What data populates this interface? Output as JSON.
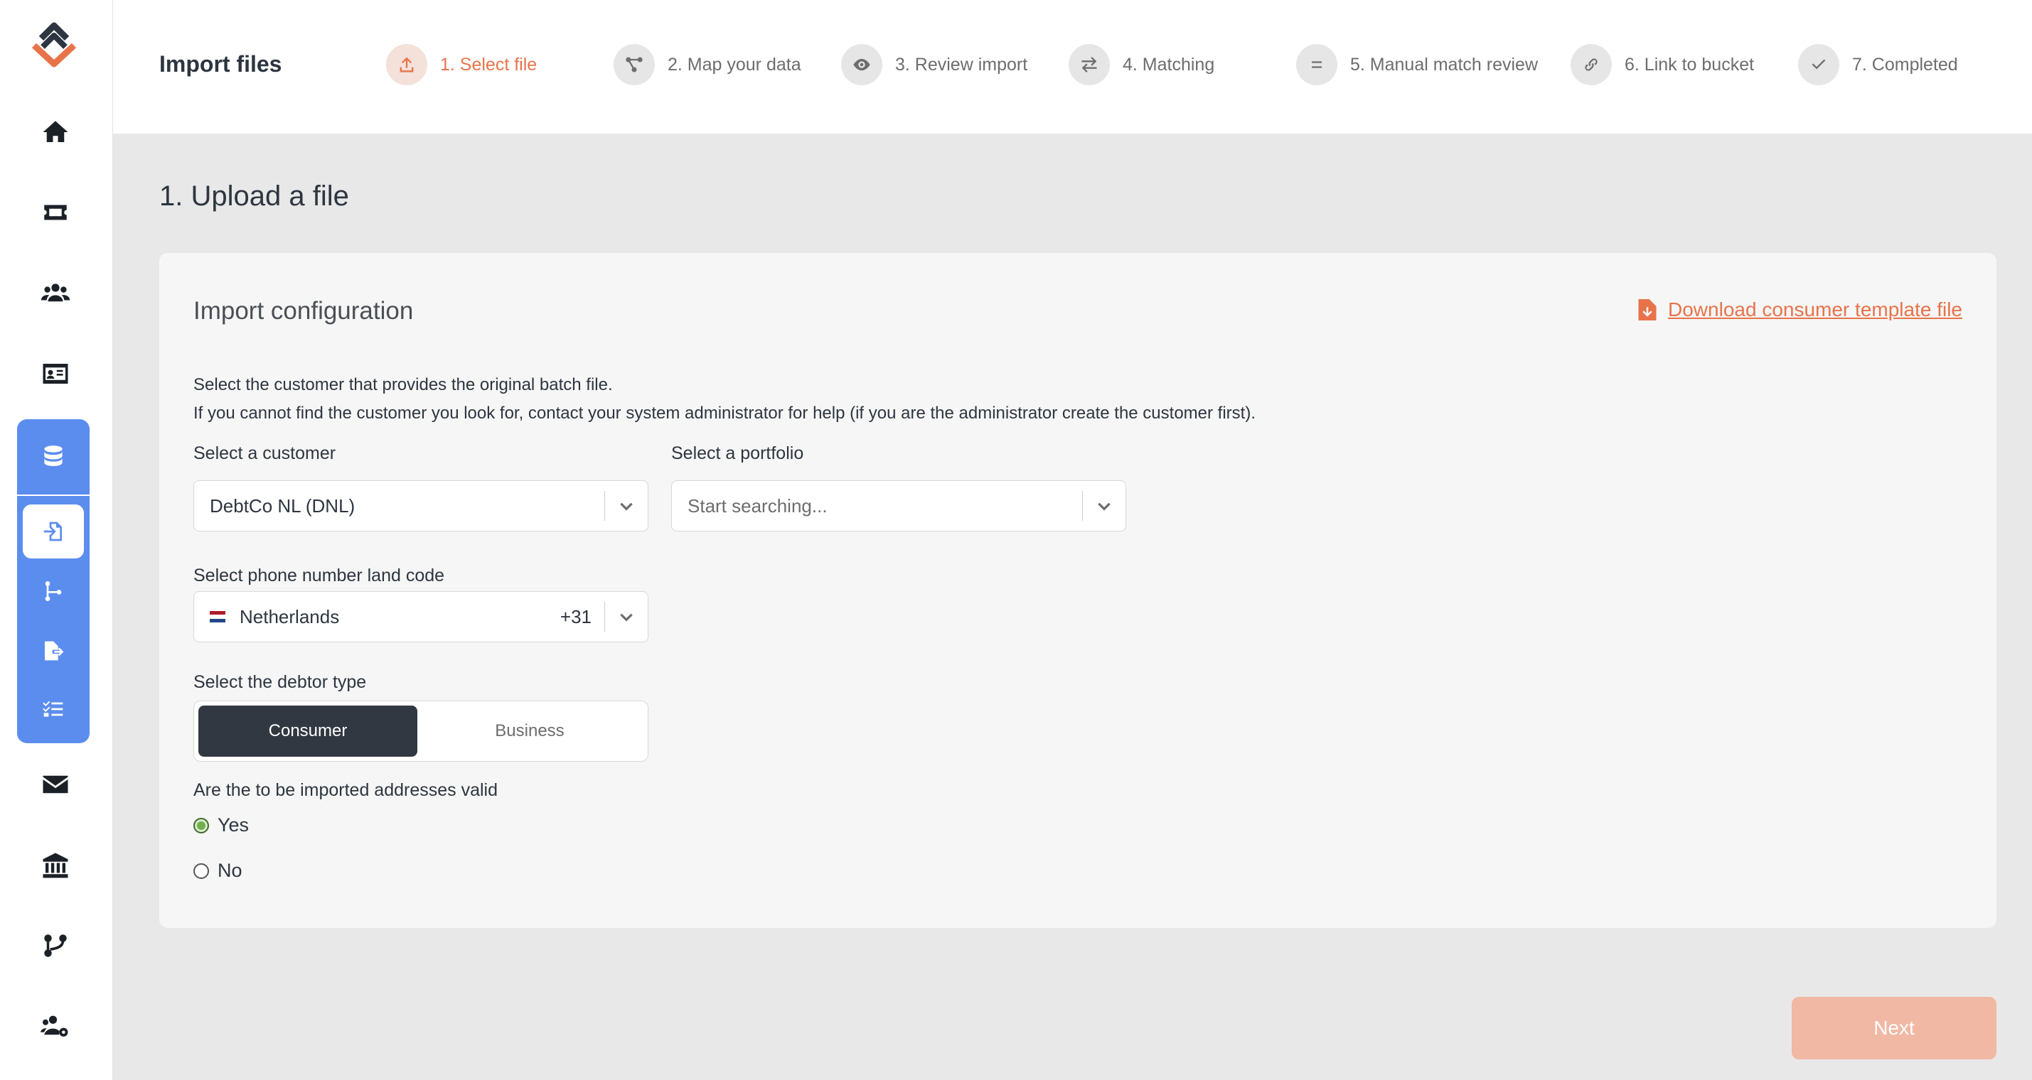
{
  "header": {
    "title": "Import files",
    "steps": [
      {
        "label": "1. Select file",
        "icon": "upload-icon",
        "active": true
      },
      {
        "label": "2. Map your data",
        "icon": "map-icon",
        "active": false
      },
      {
        "label": "3. Review import",
        "icon": "eye-icon",
        "active": false
      },
      {
        "label": "4. Matching",
        "icon": "swap-arrows-icon",
        "active": false
      },
      {
        "label": "5. Manual match review",
        "icon": "equals-icon",
        "active": false
      },
      {
        "label": "6. Link to bucket",
        "icon": "link-icon",
        "active": false
      },
      {
        "label": "7. Completed",
        "icon": "check-icon",
        "active": false
      }
    ]
  },
  "sidebar": {
    "items": [
      "home-icon",
      "ticket-icon",
      "users-icon",
      "id-card-icon",
      "database-icon",
      "mail-icon",
      "bank-icon",
      "branch-icon",
      "users-gear-icon"
    ],
    "sub_items": [
      "file-import-icon",
      "flow-icon",
      "file-export-icon",
      "checklist-icon"
    ]
  },
  "main": {
    "title": "1. Upload a file",
    "card": {
      "title": "Import configuration",
      "download_link": "Download consumer template file",
      "desc_line1": "Select the customer that provides the original batch file.",
      "desc_line2": "If you cannot find the customer you look for, contact your system administrator for help (if you are the administrator create the customer first).",
      "customer": {
        "label": "Select a customer",
        "value": "DebtCo NL (DNL)"
      },
      "portfolio": {
        "label": "Select a portfolio",
        "placeholder": "Start searching..."
      },
      "phone": {
        "label": "Select phone number land code",
        "country": "Netherlands",
        "code": "+31"
      },
      "debtor_type": {
        "label": "Select the debtor type",
        "options": [
          "Consumer",
          "Business"
        ],
        "selected": "Consumer"
      },
      "addresses": {
        "label": "Are the to be imported addresses valid",
        "options": [
          "Yes",
          "No"
        ],
        "selected": "Yes"
      }
    }
  },
  "footer": {
    "next_label": "Next"
  },
  "colors": {
    "accent": "#e8734a",
    "sidebar_active": "#5b8def",
    "dark": "#323842"
  }
}
